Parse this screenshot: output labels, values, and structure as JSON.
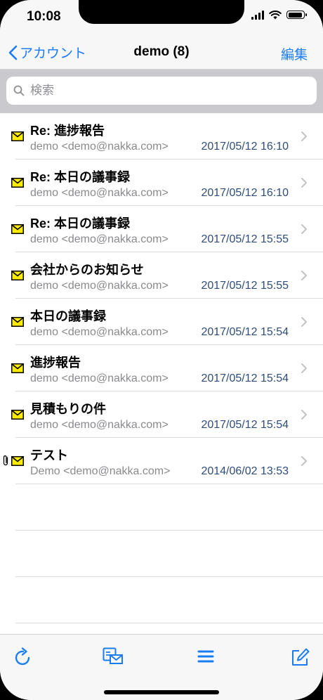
{
  "status_bar": {
    "time": "10:08"
  },
  "nav": {
    "back_label": "アカウント",
    "title": "demo (8)",
    "edit_label": "編集"
  },
  "search": {
    "placeholder": "検索"
  },
  "messages": [
    {
      "subject": "Re: 進捗報告",
      "sender": "demo <demo@nakka.com>",
      "date": "2017/05/12 16:10",
      "attachment": false
    },
    {
      "subject": "Re: 本日の議事録",
      "sender": "demo <demo@nakka.com>",
      "date": "2017/05/12 16:10",
      "attachment": false
    },
    {
      "subject": "Re: 本日の議事録",
      "sender": "demo <demo@nakka.com>",
      "date": "2017/05/12 15:55",
      "attachment": false
    },
    {
      "subject": "会社からのお知らせ",
      "sender": "demo <demo@nakka.com>",
      "date": "2017/05/12 15:55",
      "attachment": false
    },
    {
      "subject": "本日の議事録",
      "sender": "demo <demo@nakka.com>",
      "date": "2017/05/12 15:54",
      "attachment": false
    },
    {
      "subject": "進捗報告",
      "sender": "demo <demo@nakka.com>",
      "date": "2017/05/12 15:54",
      "attachment": false
    },
    {
      "subject": "見積もりの件",
      "sender": "demo <demo@nakka.com>",
      "date": "2017/05/12 15:54",
      "attachment": false
    },
    {
      "subject": "テスト",
      "sender": "Demo <demo@nakka.com>",
      "date": "2014/06/02 13:53",
      "attachment": true
    }
  ],
  "toolbar": {
    "icons": [
      "refresh-icon",
      "mail-folder-icon",
      "menu-icon",
      "compose-icon"
    ]
  },
  "colors": {
    "accent": "#1a7cf3",
    "date": "#2e4c7a",
    "envelope": "#ffeb00"
  }
}
